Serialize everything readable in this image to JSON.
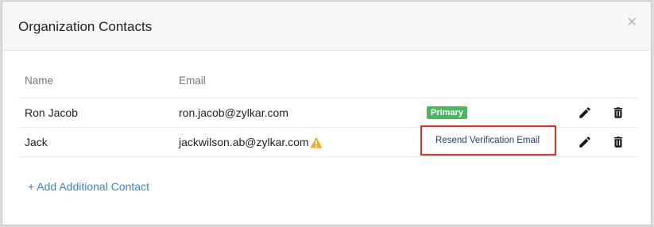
{
  "modal": {
    "title": "Organization Contacts",
    "close_icon": "close-icon"
  },
  "table": {
    "headers": {
      "name": "Name",
      "email": "Email"
    },
    "rows": [
      {
        "name": "Ron Jacob",
        "email": "ron.jacob@zylkar.com",
        "status": "Primary"
      },
      {
        "name": "Jack",
        "email": "jackwilson.ab@zylkar.com",
        "action": "Resend Verification Email",
        "warning_icon": "warning-icon"
      }
    ]
  },
  "add_contact_label": "+ Add Additional Contact",
  "colors": {
    "primary_badge": "#4cb560",
    "link": "#3e84c5",
    "highlight_border": "#e0301e",
    "warning": "#f0a92e"
  }
}
